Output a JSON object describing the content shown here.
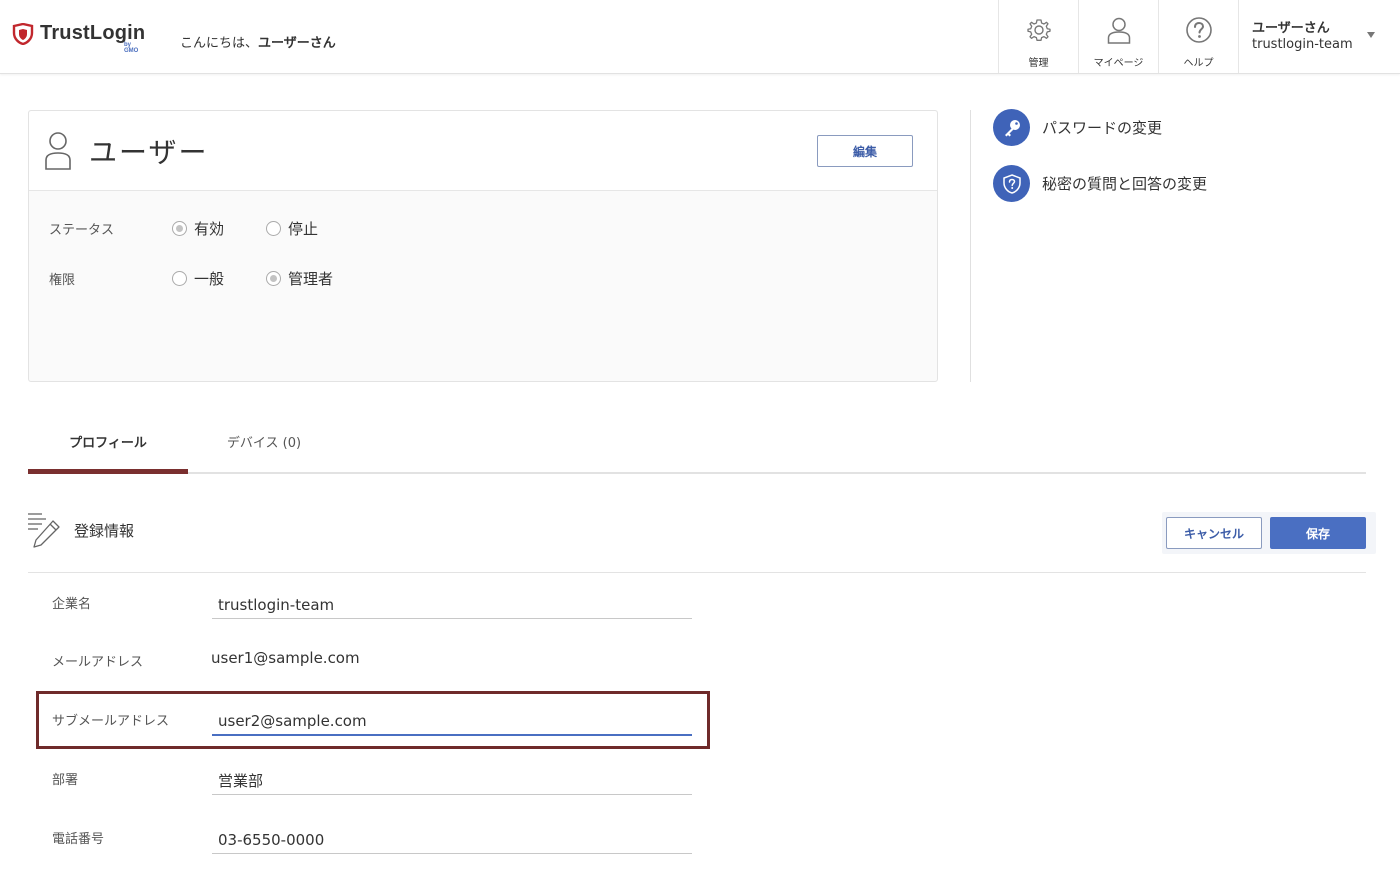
{
  "header": {
    "logo_text": "TrustLogin",
    "logo_sub": "by GMO",
    "greeting_prefix": "こんにちは、",
    "greeting_user": "ユーザーさん",
    "nav": [
      {
        "label": "管理",
        "icon": "gear-icon"
      },
      {
        "label": "マイページ",
        "icon": "user-icon"
      },
      {
        "label": "ヘルプ",
        "icon": "help-icon"
      }
    ],
    "user_name": "ユーザーさん",
    "team_name": "trustlogin-team"
  },
  "user_card": {
    "title": "ユーザー",
    "edit_label": "編集",
    "status_label": "ステータス",
    "status_options": [
      "有効",
      "停止"
    ],
    "status_selected": "有効",
    "role_label": "権限",
    "role_options": [
      "一般",
      "管理者"
    ],
    "role_selected": "管理者"
  },
  "side_links": [
    {
      "label": "パスワードの変更",
      "icon": "key-icon"
    },
    {
      "label": "秘密の質問と回答の変更",
      "icon": "shield-question-icon"
    }
  ],
  "tabs": [
    {
      "label": "プロフィール",
      "active": true
    },
    {
      "label": "デバイス (0)",
      "active": false
    }
  ],
  "section": {
    "title": "登録情報",
    "cancel_label": "キャンセル",
    "save_label": "保存"
  },
  "fields": {
    "company": {
      "label": "企業名",
      "value": "trustlogin-team"
    },
    "email": {
      "label": "メールアドレス",
      "value": "user1@sample.com"
    },
    "sub_email": {
      "label": "サブメールアドレス",
      "value": "user2@sample.com"
    },
    "department": {
      "label": "部署",
      "value": "営業部"
    },
    "phone": {
      "label": "電話番号",
      "value": "03-6550-0000"
    }
  },
  "colors": {
    "accent": "#4a6fc2",
    "tab_active": "#7a2f2f",
    "highlight": "#6f2a2a",
    "logo_red": "#c1272d"
  }
}
